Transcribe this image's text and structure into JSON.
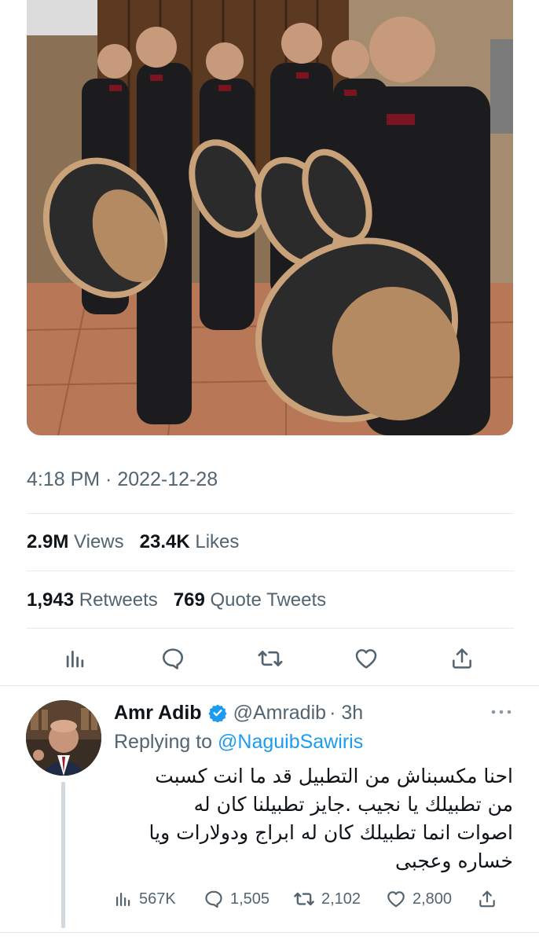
{
  "tweet": {
    "timestamp": "4:18 PM · 2022-12-28",
    "stats": {
      "views_count": "2.9M",
      "views_label": "Views",
      "likes_count": "23.4K",
      "likes_label": "Likes",
      "retweets_count": "1,943",
      "retweets_label": "Retweets",
      "quotes_count": "769",
      "quotes_label": "Quote Tweets"
    },
    "actions": [
      "analytics-icon",
      "reply-icon",
      "retweet-icon",
      "like-icon",
      "share-icon"
    ]
  },
  "reply": {
    "author_name": "Amr Adib",
    "author_handle": "@Amradib",
    "time": "· 3h",
    "replying_to_label": "Replying to",
    "replying_to_handle": "@NaguibSawiris",
    "text_lines": [
      "احنا مكسبناش من التطبيل قد ما انت كسبت",
      "من تطبيلك يا نجيب .جايز تطبيلنا كان له",
      "اصوات انما تطبيلك كان له ابراج ودولارات ويا",
      "خساره وعجبى"
    ],
    "metrics": {
      "views": "567K",
      "replies": "1,505",
      "retweets": "2,102",
      "likes": "2,800"
    }
  },
  "colors": {
    "text_primary": "#0f1419",
    "text_secondary": "#536471",
    "link": "#1d9bf0",
    "divider": "#e6e9ec"
  }
}
